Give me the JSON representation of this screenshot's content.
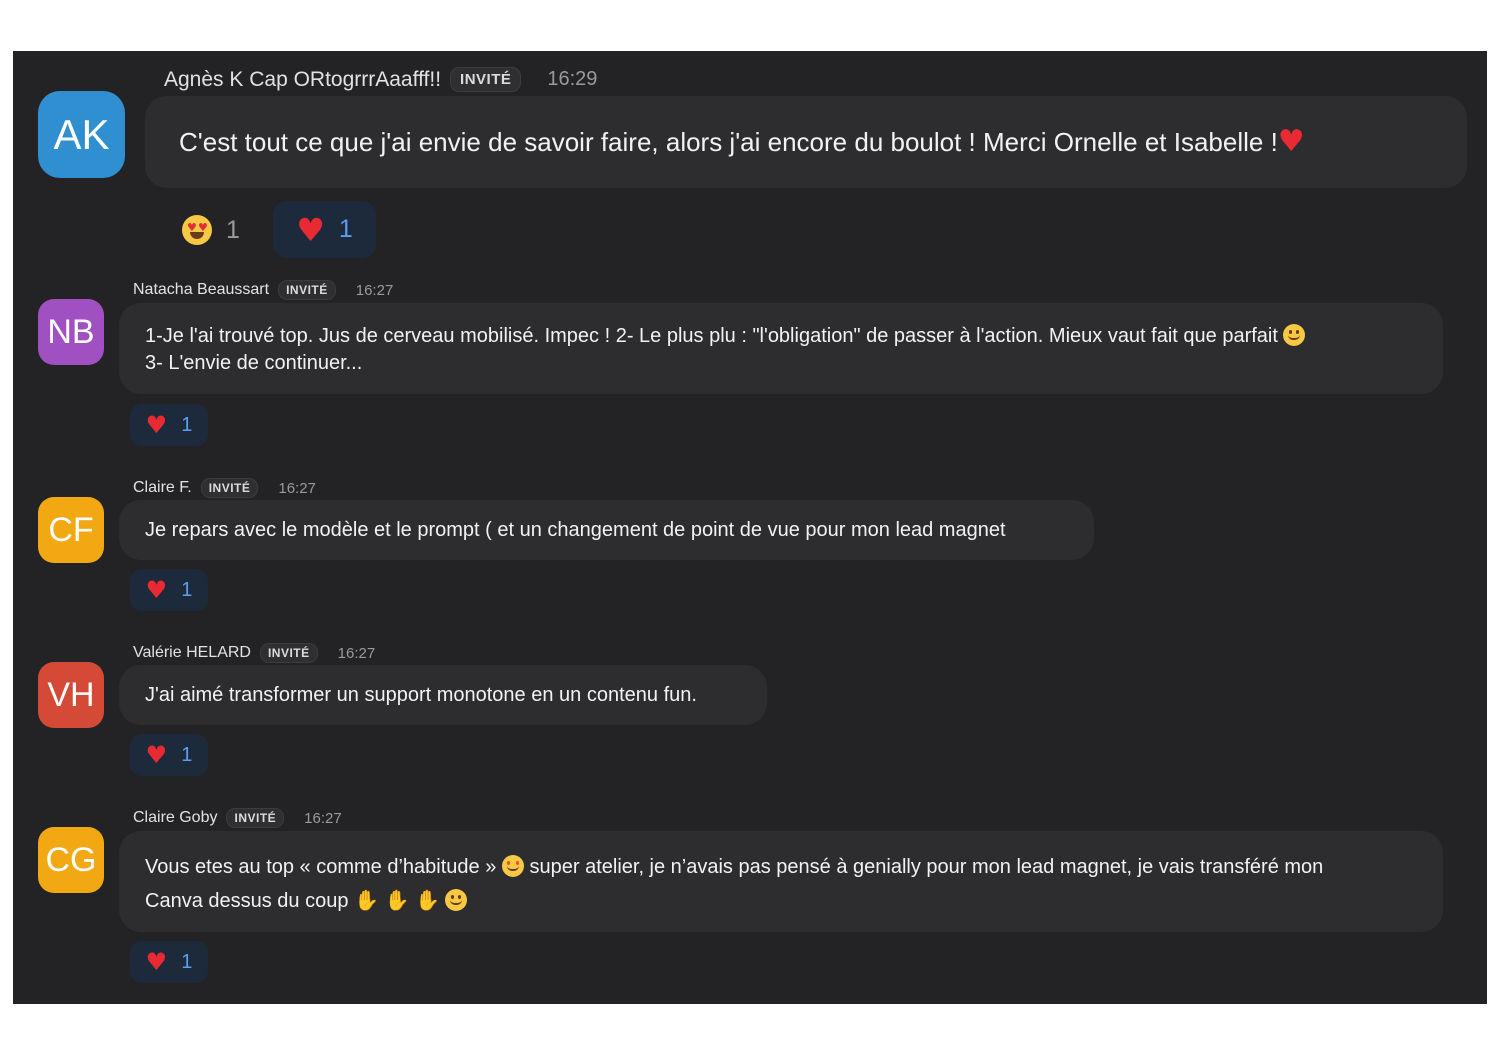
{
  "messages": [
    {
      "initials": "AK",
      "avatar_color": "#2f8fd0",
      "author": "Agnès K Cap ORtogrrrAaafff!!",
      "badge": "INVITÉ",
      "time": "16:29",
      "text": "C'est tout ce que j'ai envie de savoir faire, alors j'ai encore du boulot ! Merci Ornelle et Isabelle !",
      "trailing_icon": "red-heart-icon",
      "reactions": [
        {
          "icon": "heart-eyes-face-icon",
          "count": "1"
        },
        {
          "icon": "red-heart-icon",
          "count": "1"
        }
      ]
    },
    {
      "initials": "NB",
      "avatar_color": "#a050c0",
      "author": "Natacha Beaussart",
      "badge": "INVITÉ",
      "time": "16:27",
      "text_line1": "1-Je l'ai trouvé top. Jus de cerveau mobilisé. Impec ! 2- Le plus plu : \"l'obligation\" de passer à l'action. Mieux vaut fait que parfait",
      "inline_icon": "slightly-smiling-face-icon",
      "text_line2": "3- L'envie de continuer...",
      "reactions": [
        {
          "icon": "red-heart-icon",
          "count": "1"
        }
      ]
    },
    {
      "initials": "CF",
      "avatar_color": "#f2a812",
      "author": "Claire F.",
      "badge": "INVITÉ",
      "time": "16:27",
      "text": "Je repars avec le modèle et le prompt ( et un changement de point de vue pour mon lead magnet",
      "reactions": [
        {
          "icon": "red-heart-icon",
          "count": "1"
        }
      ]
    },
    {
      "initials": "VH",
      "avatar_color": "#d44a36",
      "author": "Valérie HELARD",
      "badge": "INVITÉ",
      "time": "16:27",
      "text": "J'ai aimé transformer un support monotone en un contenu fun.",
      "reactions": [
        {
          "icon": "red-heart-icon",
          "count": "1"
        }
      ]
    },
    {
      "initials": "CG",
      "avatar_color": "#f2a812",
      "author": "Claire Goby",
      "badge": "INVITÉ",
      "time": "16:27",
      "text_line1_a": "Vous etes au top « comme d’habitude »",
      "inline_icon_1": "star-struck-face-icon",
      "text_line1_b": "super atelier, je n’avais pas pensé à genially pour mon lead magnet, je vais transféré mon",
      "text_line2": "Canva dessus du coup",
      "trailing_icons": [
        "clapping-hands-icon",
        "clapping-hands-icon",
        "clapping-hands-icon",
        "smiling-face-with-hearts-icon"
      ],
      "reactions": [
        {
          "icon": "red-heart-icon",
          "count": "1"
        }
      ]
    }
  ],
  "colors": {
    "background": "#232325",
    "bubble": "#2d2d30",
    "reaction_active_bg": "#1d2a3b",
    "reaction_count": "#5a9ef0",
    "heart": "#ea2a33"
  }
}
